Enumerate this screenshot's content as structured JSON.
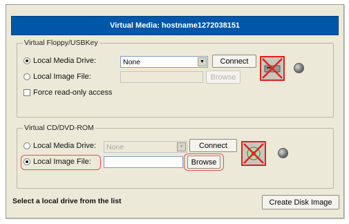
{
  "window": {
    "title": "Virtual Media: hostname1272038151"
  },
  "floppy_group": {
    "legend": "Virtual Floppy/USBKey",
    "local_media_drive_label": "Local Media Drive:",
    "local_media_drive_selected": true,
    "drive_select_value": "None",
    "connect_label": "Connect",
    "local_image_file_label": "Local Image File:",
    "local_image_file_selected": false,
    "image_file_value": "",
    "browse_label": "Browse",
    "browse_enabled": false,
    "force_readonly_label": "Force read-only access",
    "force_readonly_checked": false,
    "drive_icon": "disconnected-floppy-icon",
    "status_led": "gray-led-icon"
  },
  "cdrom_group": {
    "legend": "Virtual CD/DVD-ROM",
    "local_media_drive_label": "Local Media Drive:",
    "local_media_drive_selected": false,
    "drive_select_value": "None",
    "connect_label": "Connect",
    "local_image_file_label": "Local Image File:",
    "local_image_file_selected": true,
    "image_file_value": "",
    "browse_label": "Browse",
    "browse_enabled": true,
    "drive_icon": "disconnected-cdrom-icon",
    "status_led": "gray-led-icon"
  },
  "footer": {
    "status_text": "Select a local drive from the list",
    "create_disk_image_label": "Create Disk Image"
  },
  "colors": {
    "title_bar": "#0057a8",
    "window_bg": "#ece9d8",
    "highlight": "#e05050",
    "disconnected_x": "#e02020"
  }
}
